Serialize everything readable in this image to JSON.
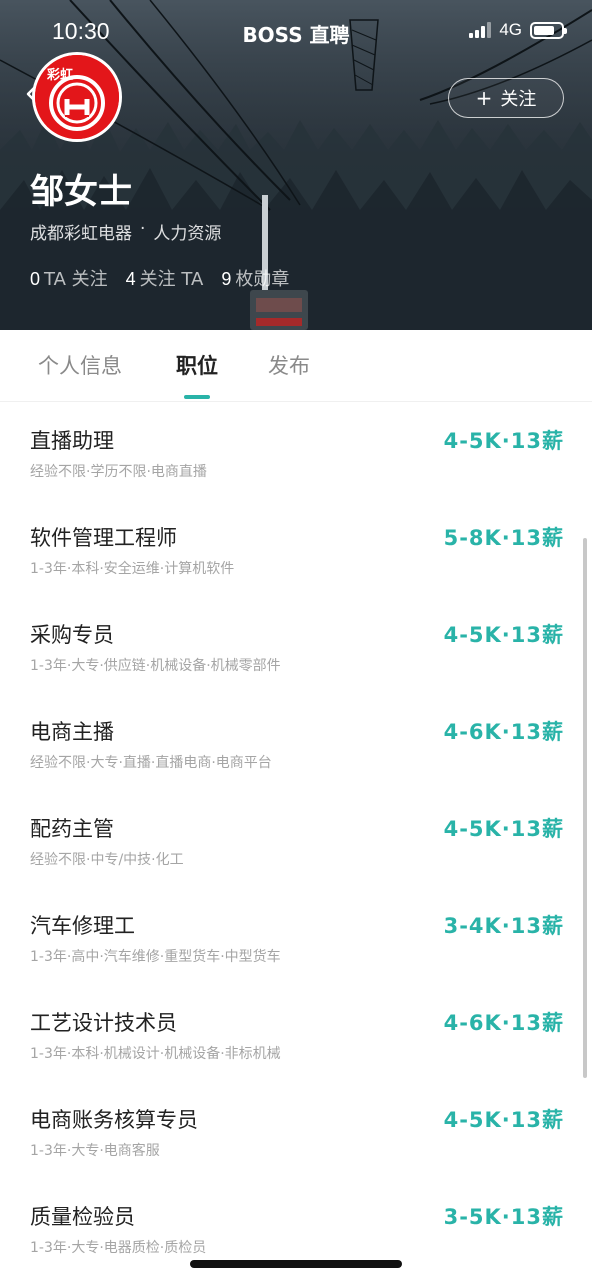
{
  "status_bar": {
    "time": "10:30",
    "app_title": "BOSS 直聘",
    "network": "4G",
    "icons": [
      "signal-icon",
      "battery-icon"
    ]
  },
  "profile": {
    "name": "邹女士",
    "company": "成都彩虹电器",
    "separator": "·",
    "department": "人力资源",
    "follow_button": "关注",
    "follow_icon": "+",
    "avatar_logo_text": "彩虹",
    "stats": [
      {
        "count": "0",
        "label": "TA 关注"
      },
      {
        "count": "4",
        "label": "关注 TA"
      },
      {
        "count": "9",
        "label": "枚勋章"
      }
    ]
  },
  "tabs": [
    {
      "label": "个人信息",
      "active": false
    },
    {
      "label": "职位",
      "active": true
    },
    {
      "label": "发布",
      "active": false
    }
  ],
  "colors": {
    "accent": "#29b3a8",
    "logo_red": "#e3161a"
  },
  "jobs": [
    {
      "title": "直播助理",
      "salary": "4-5K·13薪",
      "tags": "经验不限·学历不限·电商直播"
    },
    {
      "title": "软件管理工程师",
      "salary": "5-8K·13薪",
      "tags": "1-3年·本科·安全运维·计算机软件"
    },
    {
      "title": "采购专员",
      "salary": "4-5K·13薪",
      "tags": "1-3年·大专·供应链·机械设备·机械零部件"
    },
    {
      "title": "电商主播",
      "salary": "4-6K·13薪",
      "tags": "经验不限·大专·直播·直播电商·电商平台"
    },
    {
      "title": "配药主管",
      "salary": "4-5K·13薪",
      "tags": "经验不限·中专/中技·化工"
    },
    {
      "title": "汽车修理工",
      "salary": "3-4K·13薪",
      "tags": "1-3年·高中·汽车维修·重型货车·中型货车"
    },
    {
      "title": "工艺设计技术员",
      "salary": "4-6K·13薪",
      "tags": "1-3年·本科·机械设计·机械设备·非标机械"
    },
    {
      "title": "电商账务核算专员",
      "salary": "4-5K·13薪",
      "tags": "1-3年·大专·电商客服"
    },
    {
      "title": "质量检验员",
      "salary": "3-5K·13薪",
      "tags": "1-3年·大专·电器质检·质检员"
    }
  ]
}
